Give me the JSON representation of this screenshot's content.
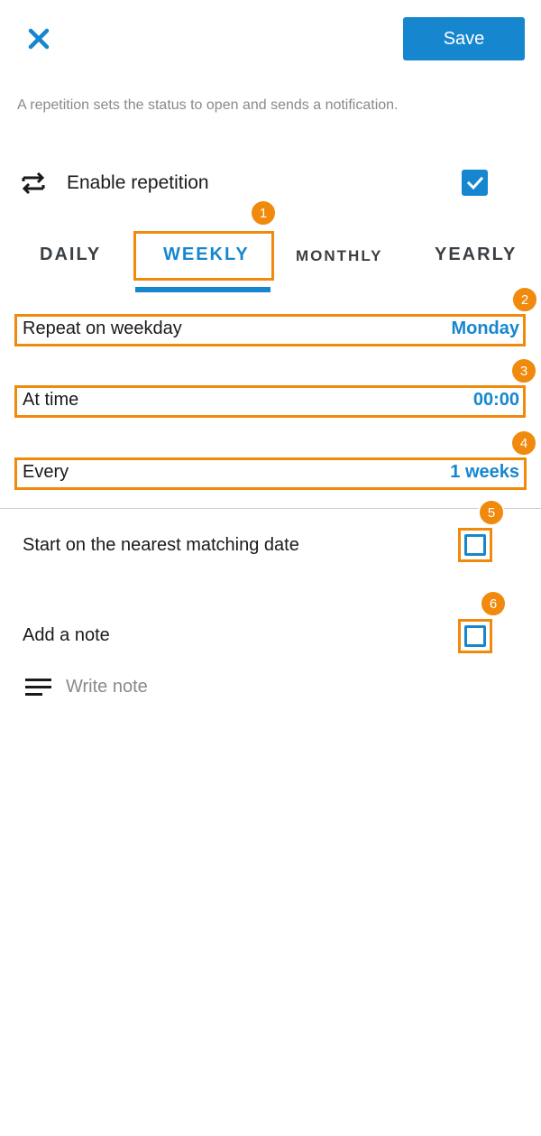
{
  "header": {
    "close_icon": "close-icon",
    "save_label": "Save"
  },
  "hint_text": "A repetition sets the status to open and sends a notification.",
  "enable_repetition": {
    "icon": "repeat-icon",
    "label": "Enable repetition",
    "checked": true
  },
  "tabs": [
    {
      "label": "DAILY",
      "active": false
    },
    {
      "label": "WEEKLY",
      "active": true
    },
    {
      "label": "MONTHLY",
      "active": false
    },
    {
      "label": "YEARLY",
      "active": false
    }
  ],
  "settings": {
    "weekday": {
      "label": "Repeat on weekday",
      "value": "Monday"
    },
    "time": {
      "label": "At time",
      "value": "00:00"
    },
    "every": {
      "label": "Every",
      "value": "1 weeks"
    }
  },
  "start_nearest": {
    "label": "Start on the nearest matching date",
    "checked": false
  },
  "add_note": {
    "label": "Add a note",
    "checked": false
  },
  "note": {
    "icon": "notes-icon",
    "placeholder": "Write note"
  },
  "annotations": [
    "1",
    "2",
    "3",
    "4",
    "5",
    "6"
  ],
  "colors": {
    "accent": "#1687cf",
    "highlight": "#f08a0c",
    "hint": "#8a8a8a"
  }
}
